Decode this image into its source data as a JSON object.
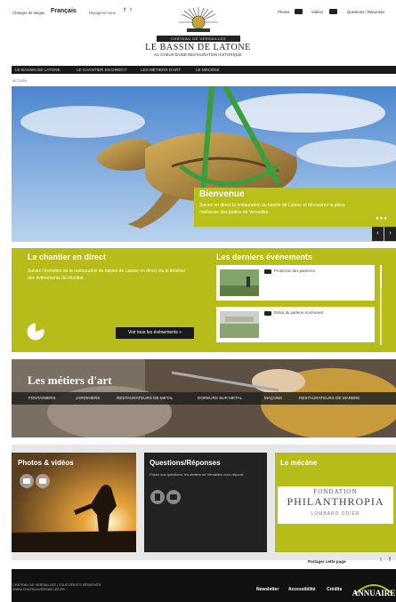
{
  "topbar": {
    "lang_label": "Changer de langue",
    "lang_current": "Français",
    "join_label": "Rejoignez-nous",
    "facebook": "f",
    "twitter": "t",
    "photos_label": "Photos",
    "videos_label": "Vidéos",
    "questions_label": "Questions / Réponses"
  },
  "logo": {
    "box_text": "CHÂTEAU DE VERSAILLES",
    "title": "LE BASSIN DE LATONE",
    "subtitle": "AU COEUR D'UNE RESTAURATION HISTORIQUE"
  },
  "nav": {
    "items": [
      "LE BASSIN DE LATONE",
      "LE CHANTIER EN DIRECT",
      "LES MÉTIERS D'ART",
      "LE MÉCÈNE"
    ]
  },
  "breadcrumb": "ACCUEIL",
  "hero": {
    "title": "Bienvenue",
    "text": "Suivez en direct la restauration du bassin de Latone et découvrez la pièce maîtresse des jardins de Versailles.",
    "dots": "●●●",
    "prev": "‹",
    "next": "›"
  },
  "chantier": {
    "title": "Le chantier en direct",
    "text": "Suivez l'évolution de la restauration du bassin de Latone en direct via la timeline des événements du chantier.",
    "button_label": "Voir tous les événements »",
    "progress": 0.2
  },
  "events": {
    "title": "Les derniers événements",
    "items": [
      {
        "label": "Protection des parterres"
      },
      {
        "label": "Début du parterre nord-ouest"
      }
    ]
  },
  "metiers": {
    "title": "Les métiers d'art",
    "items": [
      "FONTAINIERS",
      "JARDINIERS",
      "RESTAURATEURS DE METAL",
      "DOREURS SUR METAL",
      "MAÇONS",
      "RESTAURATEURS DE MARBRE"
    ]
  },
  "photos": {
    "title": "Photos & vidéos"
  },
  "qa": {
    "title": "Questions/Réponses",
    "text": "Posez vos questions, les ateliers de Versailles vous répond."
  },
  "mecene": {
    "title": "Le mécène",
    "fondation_l1": "FONDATION",
    "fondation_l2": "PHILANTHROPIA",
    "fondation_l3": "LOMBARD ODIER"
  },
  "share": {
    "label": "Partager cette page",
    "twitter": "t",
    "facebook": "f"
  },
  "footer": {
    "line1": "CHÂTEAU DE VERSAILLES | TOUS DROITS RÉSERVÉS",
    "line2": "WWW.CHATEAUVERSAILLES.FR",
    "links": [
      "Newsletter",
      "Accessibilité",
      "Crédits"
    ],
    "annuaire": "ANNUAIRE"
  },
  "colors": {
    "accent": "#b6bd1a",
    "dark": "#1a1a1a"
  }
}
